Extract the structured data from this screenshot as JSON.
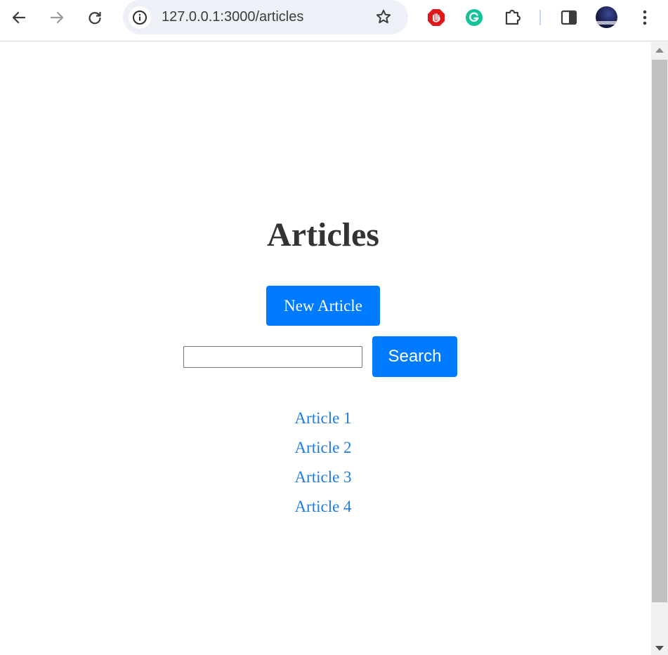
{
  "browser": {
    "url": "127.0.0.1:3000/articles"
  },
  "page": {
    "title": "Articles",
    "new_article_label": "New Article",
    "search": {
      "value": "",
      "button_label": "Search"
    },
    "articles": [
      {
        "label": "Article 1"
      },
      {
        "label": "Article 2"
      },
      {
        "label": "Article 3"
      },
      {
        "label": "Article 4"
      }
    ]
  },
  "colors": {
    "accent": "#007bff",
    "link": "#1e7be0",
    "heading": "#333333"
  }
}
